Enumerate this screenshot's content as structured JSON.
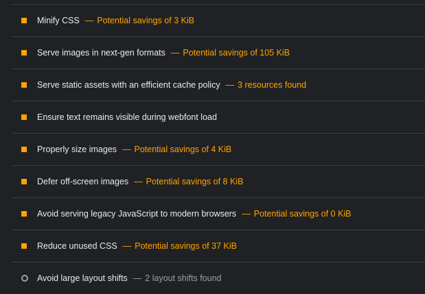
{
  "colors": {
    "warning": "#ffa400",
    "passed_grey": "#9aa0a6",
    "divider": "#3c4043",
    "background": "#202124",
    "text": "#e8eaed"
  },
  "audits": [
    {
      "title": "Minify CSS",
      "display_value": "Potential savings of 3 KiB",
      "status": "warning",
      "icon": "orange-square-icon"
    },
    {
      "title": "Serve images in next-gen formats",
      "display_value": "Potential savings of 105 KiB",
      "status": "warning",
      "icon": "orange-square-icon"
    },
    {
      "title": "Serve static assets with an efficient cache policy",
      "display_value": "3 resources found",
      "status": "warning",
      "icon": "orange-square-icon"
    },
    {
      "title": "Ensure text remains visible during webfont load",
      "display_value": "",
      "status": "warning",
      "icon": "orange-square-icon"
    },
    {
      "title": "Properly size images",
      "display_value": "Potential savings of 4 KiB",
      "status": "warning",
      "icon": "orange-square-icon"
    },
    {
      "title": "Defer off-screen images",
      "display_value": "Potential savings of 8 KiB",
      "status": "warning",
      "icon": "orange-square-icon"
    },
    {
      "title": "Avoid serving legacy JavaScript to modern browsers",
      "display_value": "Potential savings of 0 KiB",
      "status": "warning",
      "icon": "orange-square-icon"
    },
    {
      "title": "Reduce unused CSS",
      "display_value": "Potential savings of 37 KiB",
      "status": "warning",
      "icon": "orange-square-icon"
    },
    {
      "title": "Avoid large layout shifts",
      "display_value": "2 layout shifts found",
      "status": "informative",
      "icon": "grey-circle-icon"
    }
  ],
  "separator": "—"
}
